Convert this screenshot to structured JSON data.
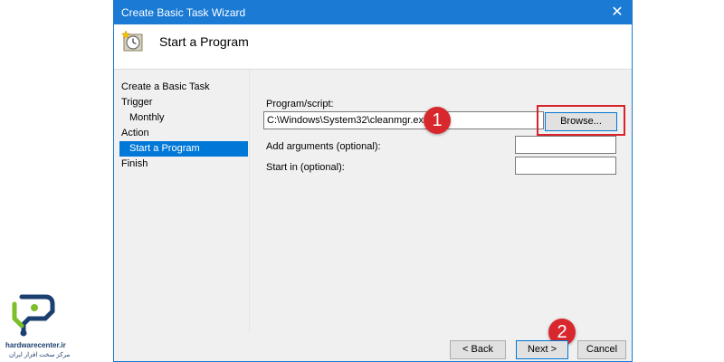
{
  "window": {
    "title": "Create Basic Task Wizard",
    "close_glyph": "✕",
    "heading": "Start a Program"
  },
  "sidebar": {
    "items": [
      {
        "label": "Create a Basic Task"
      },
      {
        "label": "Trigger"
      },
      {
        "label": "Monthly"
      },
      {
        "label": "Action"
      },
      {
        "label": "Start a Program",
        "selected": true
      },
      {
        "label": "Finish"
      }
    ]
  },
  "form": {
    "program_label": "Program/script:",
    "program_value": "C:\\Windows\\System32\\cleanmgr.exe",
    "browse_label": "Browse...",
    "args_label": "Add arguments (optional):",
    "args_value": "",
    "startin_label": "Start in (optional):",
    "startin_value": ""
  },
  "footer": {
    "back_label": "< Back",
    "next_label": "Next >",
    "cancel_label": "Cancel"
  },
  "annotations": {
    "step1": "1",
    "step2": "2",
    "highlight_color": "#d9232a"
  },
  "watermark": {
    "brand": "hardwarecenter.ir",
    "tagline": "مرکز سخت افزار ایران"
  },
  "colors": {
    "titlebar": "#1a7ad4",
    "selection": "#0078d7",
    "badge": "#d8282e"
  }
}
